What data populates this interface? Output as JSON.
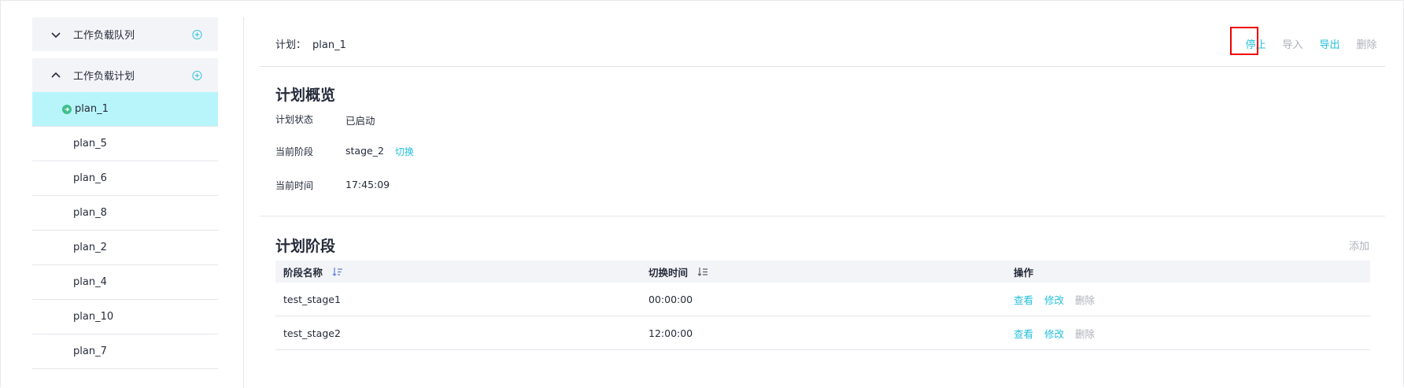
{
  "sidebar": {
    "groups": [
      {
        "label": "工作负载队列",
        "expanded": false,
        "icon": "chevron-down-icon",
        "add_icon": "plus-circle-icon"
      },
      {
        "label": "工作负载计划",
        "expanded": true,
        "icon": "chevron-up-icon",
        "add_icon": "plus-circle-icon"
      }
    ],
    "items": [
      {
        "label": "plan_1",
        "active": true,
        "status_icon": "running-arrow-icon"
      },
      {
        "label": "plan_5"
      },
      {
        "label": "plan_6"
      },
      {
        "label": "plan_8"
      },
      {
        "label": "plan_2"
      },
      {
        "label": "plan_4"
      },
      {
        "label": "plan_10"
      },
      {
        "label": "plan_7"
      }
    ]
  },
  "header": {
    "plan_label": "计划：",
    "plan_name": "plan_1",
    "actions": {
      "stop": "停止",
      "import": "导入",
      "export": "导出",
      "delete": "删除"
    }
  },
  "overview": {
    "title": "计划概览",
    "status_label": "计划状态",
    "status_value": "已启动",
    "stage_label": "当前阶段",
    "stage_value": "stage_2",
    "switch_link": "切换",
    "time_label": "当前时间",
    "time_value": "17:45:09"
  },
  "stages": {
    "title": "计划阶段",
    "add_label": "添加",
    "columns": [
      "阶段名称",
      "切换时间",
      "操作"
    ],
    "rows": [
      {
        "name": "test_stage1",
        "time": "00:00:00",
        "ops": [
          "查看",
          "修改",
          "删除"
        ]
      },
      {
        "name": "test_stage2",
        "time": "12:00:00",
        "ops": [
          "查看",
          "修改",
          "删除"
        ]
      }
    ]
  },
  "colors": {
    "accent": "#24c0db",
    "active_bg": "#b8f5fa",
    "muted": "#adb0b8",
    "highlight_box": "#ef0000"
  }
}
